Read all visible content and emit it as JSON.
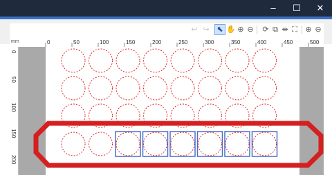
{
  "window": {
    "controls": {
      "minimize": "–",
      "maximize": "☐",
      "close": "✕"
    }
  },
  "toolbar": {
    "tools": [
      {
        "name": "undo",
        "glyph": "↩"
      },
      {
        "name": "redo",
        "glyph": "↪"
      },
      {
        "name": "select",
        "glyph": "⬉",
        "active": true
      },
      {
        "name": "pan",
        "glyph": "✋"
      },
      {
        "name": "zoom-in",
        "glyph": "⊕"
      },
      {
        "name": "zoom-out",
        "glyph": "⊖"
      },
      {
        "name": "rotate",
        "glyph": "⟳"
      },
      {
        "name": "align",
        "glyph": "⧉"
      },
      {
        "name": "distribute",
        "glyph": "⇹"
      },
      {
        "name": "fit",
        "glyph": "⛶"
      },
      {
        "name": "zoom-in-2",
        "glyph": "⊕"
      },
      {
        "name": "zoom-out-2",
        "glyph": "⊖"
      }
    ]
  },
  "ruler": {
    "unit": "mm",
    "horizontal_labels": [
      "0",
      "50",
      "100",
      "150",
      "200",
      "250",
      "300",
      "350",
      "400",
      "450",
      "500"
    ],
    "vertical_labels": [
      "0",
      "50",
      "100",
      "150",
      "200"
    ]
  },
  "layout": {
    "rows": 4,
    "cols": 8,
    "selected_row": 4,
    "selected_cols": [
      3,
      4,
      5,
      6,
      7,
      8
    ]
  },
  "colors": {
    "circle": "#e02020",
    "selection": "#4a6fc7",
    "highlight": "#d42020",
    "titlebar": "#1f2a3c",
    "accent": "#3a6fc9",
    "canvas": "#a9a9a9"
  }
}
